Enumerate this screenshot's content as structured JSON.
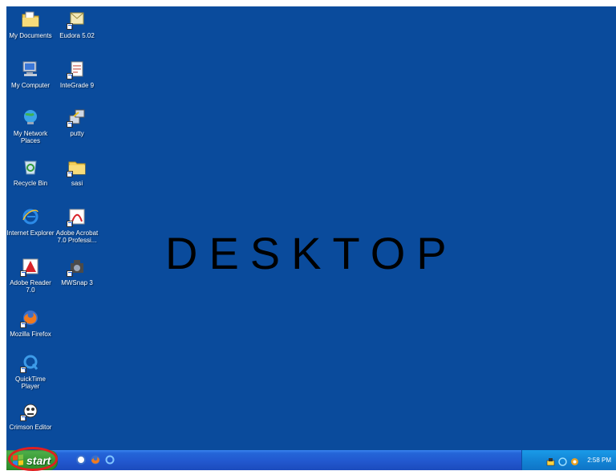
{
  "desktop": {
    "background_color": "#0a4b9c",
    "label": "DESKTOP",
    "icons": [
      {
        "label": "My Documents",
        "icon": "folder-documents-icon"
      },
      {
        "label": "Eudora 5.02",
        "icon": "eudora-icon"
      },
      {
        "label": "My Computer",
        "icon": "computer-icon"
      },
      {
        "label": "InteGrade 9",
        "icon": "integrade-icon"
      },
      {
        "label": "My Network Places",
        "icon": "network-places-icon"
      },
      {
        "label": "putty",
        "icon": "putty-icon"
      },
      {
        "label": "Recycle Bin",
        "icon": "recycle-bin-icon"
      },
      {
        "label": "sasi",
        "icon": "folder-icon"
      },
      {
        "label": "Internet Explorer",
        "icon": "internet-explorer-icon"
      },
      {
        "label": "Adobe Acrobat 7.0 Professi...",
        "icon": "adobe-acrobat-icon"
      },
      {
        "label": "Adobe Reader 7.0",
        "icon": "adobe-reader-icon"
      },
      {
        "label": "MWSnap 3",
        "icon": "mwsnap-icon"
      },
      {
        "label": "Mozilla Firefox",
        "icon": "firefox-icon"
      },
      {
        "label": "QuickTime Player",
        "icon": "quicktime-icon"
      },
      {
        "label": "Crimson Editor",
        "icon": "crimson-editor-icon"
      }
    ]
  },
  "taskbar": {
    "start_label": "start",
    "start_highlight_color": "#e02020",
    "quick_launch": [
      "show-desktop-icon",
      "firefox-icon",
      "internet-explorer-icon"
    ],
    "tray_icons": [
      "network-icon",
      "security-icon",
      "volume-icon"
    ],
    "clock": "2:58 PM"
  }
}
